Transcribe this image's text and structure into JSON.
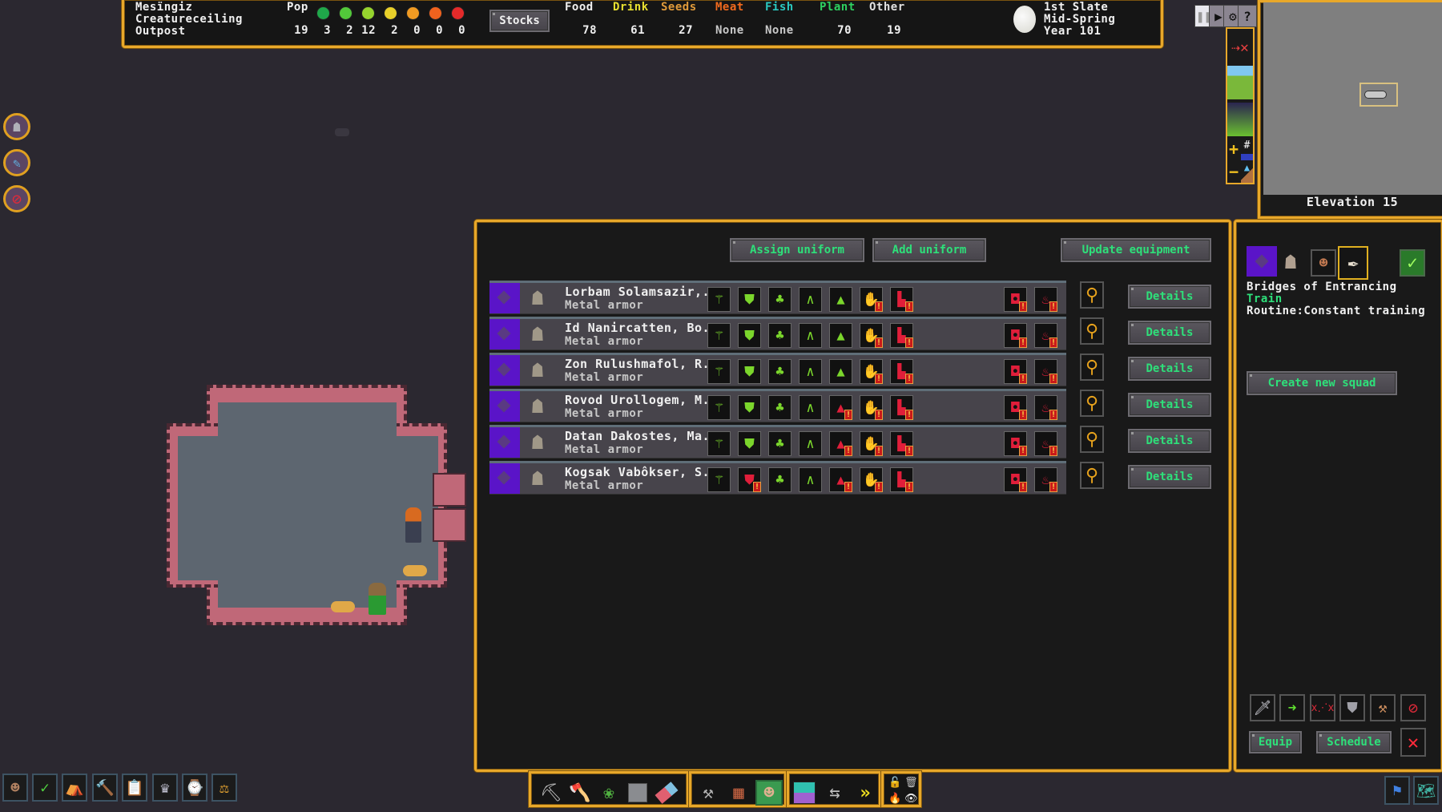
{
  "fort": {
    "name": "Mesïngiz",
    "subtitle": "Creatureceiling",
    "rank": "Outpost"
  },
  "population": {
    "label": "Pop",
    "total": "19",
    "moods": [
      {
        "name": "ecstatic",
        "count": "3",
        "color": "#1fa84a"
      },
      {
        "name": "happy",
        "count": "2",
        "color": "#52c83a"
      },
      {
        "name": "content",
        "count": "12",
        "color": "#96d42e"
      },
      {
        "name": "fine",
        "count": "2",
        "color": "#e8d02a"
      },
      {
        "name": "unhappy",
        "count": "0",
        "color": "#f09a22"
      },
      {
        "name": "very-unhappy",
        "count": "0",
        "color": "#f0621e"
      },
      {
        "name": "miserable",
        "count": "0",
        "color": "#e42a2a"
      }
    ]
  },
  "stocks_button": "Stocks",
  "stocks": [
    {
      "label": "Food",
      "value": "78",
      "color": "#f0f0f0"
    },
    {
      "label": "Drink",
      "value": "61",
      "color": "#e8e030"
    },
    {
      "label": "Seeds",
      "value": "27",
      "color": "#e09a3a"
    },
    {
      "label": "Meat",
      "value": "None",
      "color": "#f06a1e"
    },
    {
      "label": "Fish",
      "value": "None",
      "color": "#2ac8c0"
    },
    {
      "label": "Plant",
      "value": "70",
      "color": "#2ed060"
    },
    {
      "label": "Other",
      "value": "19",
      "color": "#e0e0e0"
    }
  ],
  "date": {
    "day": "1st Slate",
    "season": "Mid-Spring",
    "year": "Year 101"
  },
  "controls": {
    "pause": "pause-icon",
    "play": "▶",
    "settings": "⚙",
    "help": "?"
  },
  "minimap": {
    "elevation_label": "Elevation 15"
  },
  "left_icons": [
    "citizen-icon",
    "pacifier-icon",
    "cancel-icon"
  ],
  "squad_panel": {
    "assign_uniform": "Assign uniform",
    "add_uniform": "Add uniform",
    "update_equipment": "Update equipment",
    "details_label": "Details",
    "members": [
      {
        "name": "Lorbam Solamsazir,...",
        "uniform": "Metal armor",
        "equipment": [
          "ok",
          "ok",
          "ok",
          "ok",
          "ok",
          "bad",
          "bad"
        ],
        "extra": [
          "bad",
          "bad"
        ]
      },
      {
        "name": "Id Nanircatten, Bo...",
        "uniform": "Metal armor",
        "equipment": [
          "ok",
          "ok",
          "ok",
          "ok",
          "ok",
          "bad",
          "bad"
        ],
        "extra": [
          "bad",
          "bad"
        ]
      },
      {
        "name": "Zon Rulushmafol, R...",
        "uniform": "Metal armor",
        "equipment": [
          "ok",
          "ok",
          "ok",
          "ok",
          "ok",
          "bad",
          "bad"
        ],
        "extra": [
          "bad",
          "bad"
        ]
      },
      {
        "name": "Rovod Urollogem, M...",
        "uniform": "Metal armor",
        "equipment": [
          "ok",
          "ok",
          "ok",
          "ok",
          "bad",
          "bad",
          "bad"
        ],
        "extra": [
          "bad",
          "bad"
        ]
      },
      {
        "name": "Datan Dakostes, Ma...",
        "uniform": "Metal armor",
        "equipment": [
          "ok",
          "ok",
          "ok",
          "ok",
          "bad",
          "bad",
          "bad"
        ],
        "extra": [
          "bad",
          "bad"
        ]
      },
      {
        "name": "Kogsak Vabôkser, S...",
        "uniform": "Metal armor",
        "equipment": [
          "ok",
          "bad",
          "ok",
          "ok",
          "bad",
          "bad",
          "bad"
        ],
        "extra": [
          "bad",
          "bad"
        ]
      }
    ],
    "equipment_slots": [
      "weapon",
      "shield",
      "armor",
      "pants",
      "helm",
      "gloves",
      "boots"
    ],
    "extra_slots": [
      "backpack",
      "flask"
    ]
  },
  "side_panel": {
    "squad_name": "Bridges of Entrancing",
    "status": "Train",
    "routine": "Routine:Constant training",
    "create_new_squad": "Create new squad",
    "order_icons": [
      "sword-icon",
      "move-arrow-icon",
      "kill-list-icon",
      "shield-icon",
      "hammer-icon",
      "cancel-order-icon"
    ],
    "equip": "Equip",
    "schedule": "Schedule"
  },
  "bottom_left_icons": [
    "citizens",
    "tasks",
    "zones",
    "work-orders",
    "labor",
    "nobles",
    "objects",
    "justice"
  ],
  "bottom_tools": [
    "dig",
    "chop",
    "gather",
    "smooth",
    "erase",
    "build",
    "place-furniture",
    "assign",
    "stockpile",
    "hauling",
    "fast-forward"
  ],
  "bottom_misc": [
    "lock",
    "trash",
    "fire",
    "eye"
  ],
  "bottom_right_icons": [
    "squads-banner",
    "world-map"
  ]
}
